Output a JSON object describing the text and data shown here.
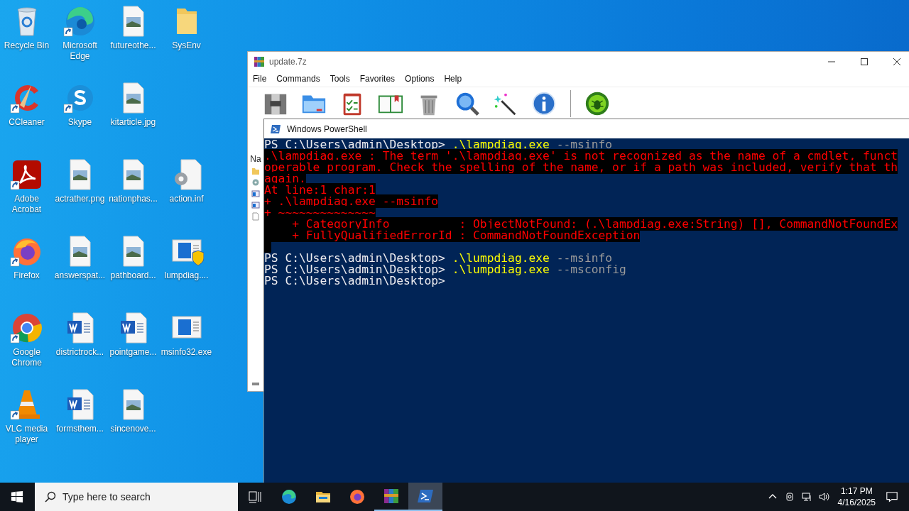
{
  "desktop_icons": [
    {
      "label": "Recycle Bin",
      "kind": "recycle",
      "shortcut": false
    },
    {
      "label": "CCleaner",
      "kind": "ccleaner",
      "shortcut": true
    },
    {
      "label": "Adobe Acrobat",
      "kind": "acrobat",
      "shortcut": true
    },
    {
      "label": "Firefox",
      "kind": "firefox",
      "shortcut": true
    },
    {
      "label": "Google Chrome",
      "kind": "chrome",
      "shortcut": true
    },
    {
      "label": "VLC media player",
      "kind": "vlc",
      "shortcut": true
    },
    {
      "label": "Microsoft Edge",
      "kind": "edge",
      "shortcut": true
    },
    {
      "label": "Skype",
      "kind": "skype",
      "shortcut": true
    },
    {
      "label": "actrather.png",
      "kind": "image",
      "shortcut": false
    },
    {
      "label": "answerspat...",
      "kind": "image",
      "shortcut": false
    },
    {
      "label": "districtrock...",
      "kind": "word",
      "shortcut": false
    },
    {
      "label": "formsthem...",
      "kind": "word",
      "shortcut": false
    },
    {
      "label": "futureothe...",
      "kind": "image",
      "shortcut": false
    },
    {
      "label": "kitarticle.jpg",
      "kind": "image",
      "shortcut": false
    },
    {
      "label": "nationphas...",
      "kind": "image",
      "shortcut": false
    },
    {
      "label": "pathboard...",
      "kind": "image",
      "shortcut": false
    },
    {
      "label": "pointgame...",
      "kind": "word",
      "shortcut": false
    },
    {
      "label": "sincenove...",
      "kind": "image",
      "shortcut": false
    },
    {
      "label": "SysEnv",
      "kind": "folder",
      "shortcut": false
    },
    {
      "label": "action.inf",
      "kind": "settings-file",
      "shortcut": false
    },
    {
      "label": "lumpdiag....",
      "kind": "app-shield",
      "shortcut": false
    },
    {
      "label": "msinfo32.exe",
      "kind": "app",
      "shortcut": false
    }
  ],
  "archiver_window": {
    "title": "update.7z",
    "menu": [
      "File",
      "Commands",
      "Tools",
      "Favorites",
      "Options",
      "Help"
    ],
    "toolbar": [
      {
        "kind": "archive"
      },
      {
        "kind": "folder"
      },
      {
        "kind": "clipboard"
      },
      {
        "kind": "book"
      },
      {
        "kind": "trash"
      },
      {
        "kind": "magnifier"
      },
      {
        "kind": "wand"
      },
      {
        "kind": "info"
      },
      {
        "kind": "separator"
      },
      {
        "kind": "bug"
      }
    ],
    "column_header": "Na"
  },
  "console_window": {
    "title": "Windows PowerShell",
    "lines": [
      {
        "segments": [
          {
            "text": "PS C:\\Users\\admin\\Desktop> ",
            "kind": "prompt"
          },
          {
            "text": ".\\lampdiag.exe",
            "kind": "command"
          },
          {
            "text": " --msinfo",
            "kind": "arg"
          }
        ]
      },
      {
        "segments": [
          {
            "text": ".\\lampdiag.exe : The term '.\\lampdiag.exe' is not recognized as the name of a cmdlet, funct",
            "kind": "error"
          }
        ]
      },
      {
        "segments": [
          {
            "text": "operable program. Check the spelling of the name, or if a path was included, verify that th",
            "kind": "error"
          }
        ]
      },
      {
        "segments": [
          {
            "text": "again.",
            "kind": "error"
          }
        ]
      },
      {
        "segments": [
          {
            "text": "At line:1 char:1",
            "kind": "error"
          }
        ]
      },
      {
        "segments": [
          {
            "text": "+ .\\lampdiag.exe --msinfo",
            "kind": "error"
          }
        ]
      },
      {
        "segments": [
          {
            "text": "+ ~~~~~~~~~~~~~~",
            "kind": "error"
          }
        ]
      },
      {
        "segments": [
          {
            "text": "    + CategoryInfo          : ObjectNotFound: (.\\lampdiag.exe:String) [], CommandNotFoundEx",
            "kind": "error"
          }
        ]
      },
      {
        "segments": [
          {
            "text": "    + FullyQualifiedErrorId : CommandNotFoundException",
            "kind": "error"
          }
        ]
      },
      {
        "segments": [
          {
            "kind": "gap"
          }
        ]
      },
      {
        "segments": [
          {
            "text": "PS C:\\Users\\admin\\Desktop> ",
            "kind": "prompt"
          },
          {
            "text": ".\\lumpdiag.exe",
            "kind": "command"
          },
          {
            "text": " --msinfo",
            "kind": "arg"
          }
        ]
      },
      {
        "segments": [
          {
            "text": "PS C:\\Users\\admin\\Desktop> ",
            "kind": "prompt"
          },
          {
            "text": ".\\lumpdiag.exe",
            "kind": "command"
          },
          {
            "text": " --msconfig",
            "kind": "arg"
          }
        ]
      },
      {
        "segments": [
          {
            "text": "PS C:\\Users\\admin\\Desktop> ",
            "kind": "prompt"
          }
        ]
      }
    ]
  },
  "taskbar": {
    "search_placeholder": "Type here to search",
    "apps": [
      {
        "kind": "edge",
        "active": false
      },
      {
        "kind": "explorer",
        "active": false
      },
      {
        "kind": "firefox",
        "active": false
      },
      {
        "kind": "archiver",
        "active": true
      },
      {
        "kind": "powershell",
        "active": true,
        "selected": true
      }
    ],
    "time": "1:17 PM",
    "date": "4/16/2025"
  }
}
